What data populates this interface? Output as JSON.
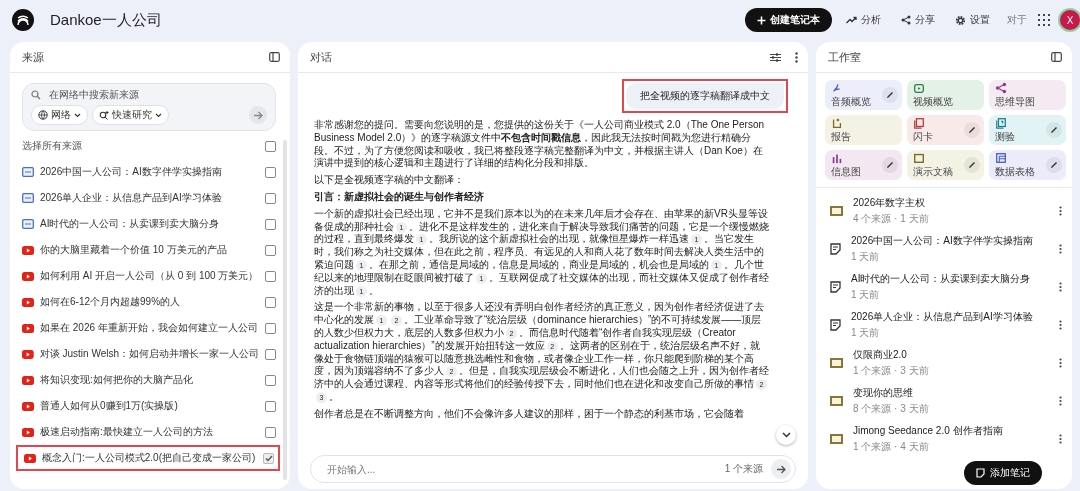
{
  "header": {
    "title": "Dankoe一人公司",
    "avatar": "X",
    "actions": [
      {
        "kind": "create",
        "label": "创建笔记本"
      },
      {
        "kind": "analytics",
        "label": "分析"
      },
      {
        "kind": "share",
        "label": "分享"
      },
      {
        "kind": "settings",
        "label": "设置"
      },
      {
        "kind": "tag",
        "label": "对于"
      },
      {
        "kind": "apps"
      }
    ]
  },
  "sources": {
    "title": "来源",
    "search": {
      "placeholder": "在网络中搜索新来源",
      "chips": [
        "网络",
        "快速研究"
      ]
    },
    "select_all": {
      "label": "选择所有来源",
      "checked": false
    },
    "items": [
      {
        "kind": "doc",
        "title": "2026中国一人公司：AI数字伴学实操指南",
        "checked": false,
        "selected": false
      },
      {
        "kind": "doc",
        "title": "2026单人企业：从信息产品到AI学习体验",
        "checked": false,
        "selected": false
      },
      {
        "kind": "doc",
        "title": "AI时代的一人公司：从卖课到卖大脑分身",
        "checked": false,
        "selected": false
      },
      {
        "kind": "video",
        "title": "你的大脑里藏着一个价值 10 万美元的产品",
        "checked": false,
        "selected": false
      },
      {
        "kind": "video",
        "title": "如何利用 AI 开启一人公司（从 0 到 100 万美元）",
        "checked": false,
        "selected": false
      },
      {
        "kind": "video",
        "title": "如何在6-12个月内超越99%的人",
        "checked": false,
        "selected": false
      },
      {
        "kind": "video",
        "title": "如果在 2026 年重新开始，我会如何建立一人公司",
        "checked": false,
        "selected": false
      },
      {
        "kind": "video",
        "title": "对谈 Justin Welsh：如何启动并增长一家一人公司",
        "checked": false,
        "selected": false
      },
      {
        "kind": "video",
        "title": "将知识变现:如何把你的大脑产品化",
        "checked": false,
        "selected": false
      },
      {
        "kind": "video",
        "title": "普通人如何从0赚到1万(实操版)",
        "checked": false,
        "selected": false
      },
      {
        "kind": "video",
        "title": "极速启动指南:最快建立一人公司的方法",
        "checked": false,
        "selected": false
      },
      {
        "kind": "video",
        "title": "概念入门:一人公司模式2.0(把自己变成一家公司)",
        "checked": true,
        "selected": true
      }
    ]
  },
  "chat": {
    "title": "对话",
    "user_message": {
      "text": "把全视频的逐字稿翻译成中文",
      "highlighted": true
    },
    "answer": [
      {
        "kind": "paragraph",
        "parts": [
          {
            "kind": "text",
            "text": "非常感谢您的提问。需要向您说明的是，您提供的这份关于《一人公司商业模式 2.0（The One Person Business Model 2.0）》的逐字稿源文件中**不包含时间戳信息**，因此我无法按时间戳为您进行精确分段。不过，为了方便您阅读和吸收，我已将整段逐字稿完整翻译为中文，并根据主讲人（Dan Koe）在演讲中提到的核心逻辑和主题进行了详细的结构化分段和排版。"
          }
        ]
      },
      {
        "kind": "paragraph",
        "parts": [
          {
            "kind": "text",
            "text": "以下是全视频逐字稿的中文翻译："
          }
        ]
      },
      {
        "kind": "heading",
        "parts": [
          {
            "kind": "text",
            "text": "引言：新虚拟社会的诞生与创作者经济"
          }
        ]
      },
      {
        "kind": "paragraph",
        "parts": [
          {
            "kind": "text",
            "text": "一个新的虚拟社会已经出现，它并不是我们原本以为的在未来几年后才会存在、由苹果的新VR头显等设备促成的那种社会"
          },
          {
            "kind": "cite",
            "text": "1"
          },
          {
            "kind": "text",
            "text": "。进化不是这样发生的，进化来自于解决导致我们痛苦的问题，它是一个缓慢燃烧的过程，直到最终爆发"
          },
          {
            "kind": "cite",
            "text": "1"
          },
          {
            "kind": "text",
            "text": "。我所说的这个新虚拟社会的出现，就像恒星爆炸一样迅速"
          },
          {
            "kind": "cite",
            "text": "1"
          },
          {
            "kind": "text",
            "text": "。当它发生时，我们称之为社交媒体，但在此之前，程序员、有远见的人和商人花了数年时间去解决人类生活中的紧迫问题"
          },
          {
            "kind": "cite",
            "text": "1"
          },
          {
            "kind": "text",
            "text": "。在那之前，通信是局域的，信息是局域的，商业是局域的，机会也是局域的"
          },
          {
            "kind": "cite",
            "text": "1"
          },
          {
            "kind": "text",
            "text": "。几个世纪以来的地理限制在眨眼间被打破了"
          },
          {
            "kind": "cite",
            "text": "1"
          },
          {
            "kind": "text",
            "text": "。互联网促成了社交媒体的出现，而社交媒体又促成了创作者经济的出现"
          },
          {
            "kind": "cite",
            "text": "1"
          },
          {
            "kind": "text",
            "text": "。"
          }
        ]
      },
      {
        "kind": "paragraph",
        "parts": [
          {
            "kind": "text",
            "text": "这是一个非常新的事物，以至于很多人还没有弄明白创作者经济的真正意义，因为创作者经济促进了去中心化的发展"
          },
          {
            "kind": "cite",
            "text": "1"
          },
          {
            "kind": "cite",
            "text": "2"
          },
          {
            "kind": "text",
            "text": "。工业革命导致了“统治层级（dominance hierarchies）”的不可持续发展——顶层的人数少但权力大，底层的人数多但权力小"
          },
          {
            "kind": "cite",
            "text": "2"
          },
          {
            "kind": "text",
            "text": "。而信息时代随着“创作者自我实现层级（Creator actualization hierarchies）”的发展开始扭转这一效应"
          },
          {
            "kind": "cite",
            "text": "2"
          },
          {
            "kind": "text",
            "text": "。这两者的区别在于，统治层级名声不好，就像处于食物链顶端的猿猴可以随意挑选雌性和食物，或者像企业工作一样，你只能爬到阶梯的某个高度，因为顶端容纳不了多少人"
          },
          {
            "kind": "cite",
            "text": "2"
          },
          {
            "kind": "text",
            "text": "。但是，自我实现层级会不断进化，人们也会随之上升，因为创作者经济中的人会通过课程、内容等形式将他们的经验传授下去，同时他们也在进化和改变自己所做的事情"
          },
          {
            "kind": "cite",
            "text": "2"
          },
          {
            "kind": "cite",
            "text": "3"
          },
          {
            "kind": "text",
            "text": "。"
          }
        ]
      },
      {
        "kind": "paragraph",
        "parts": [
          {
            "kind": "text",
            "text": "创作者总是在不断调整方向，他们不会像许多人建议的那样，困于一个静态的利基市场，它会随着"
          }
        ]
      }
    ],
    "composer": {
      "placeholder": "开始输入...",
      "source_count": "1 个来源"
    }
  },
  "studio": {
    "title": "工作室",
    "tools": [
      {
        "kind": "audio",
        "label": "音频概览",
        "color": "#eceefb",
        "editable": true
      },
      {
        "kind": "video",
        "label": "视频概览",
        "color": "#e4f1e6",
        "editable": false
      },
      {
        "kind": "mindmap",
        "label": "思维导图",
        "color": "#f5eaf1",
        "editable": false
      },
      {
        "kind": "report",
        "label": "报告",
        "color": "#f4f2e4",
        "editable": false
      },
      {
        "kind": "flashcards",
        "label": "闪卡",
        "color": "#f9eaea",
        "editable": true
      },
      {
        "kind": "quiz",
        "label": "测验",
        "color": "#e2f3f6",
        "editable": true
      },
      {
        "kind": "infographic",
        "label": "信息图",
        "color": "#f3e7f1",
        "editable": true
      },
      {
        "kind": "slides",
        "label": "演示文稿",
        "color": "#f3f2e5",
        "editable": true
      },
      {
        "kind": "table",
        "label": "数据表格",
        "color": "#ecebfa",
        "editable": true
      }
    ],
    "notes": [
      {
        "kind": "slides",
        "title": "2026年数字主权",
        "meta": "4 个来源 · 1 天前"
      },
      {
        "kind": "note",
        "title": "2026中国一人公司：AI数字伴学实操指南",
        "meta": "1 天前"
      },
      {
        "kind": "note",
        "title": "AI时代的一人公司：从卖课到卖大脑分身",
        "meta": "1 天前"
      },
      {
        "kind": "note",
        "title": "2026单人企业：从信息产品到AI学习体验",
        "meta": "1 天前"
      },
      {
        "kind": "slides",
        "title": "仅限商业2.0",
        "meta": "1 个来源 · 3 天前"
      },
      {
        "kind": "slides",
        "title": "变现你的思维",
        "meta": "8 个来源 · 3 天前"
      },
      {
        "kind": "slides",
        "title": "Jimong Seedance 2.0 创作者指南",
        "meta": "1 个来源 · 4 天前"
      }
    ],
    "add_note": "添加笔记"
  }
}
